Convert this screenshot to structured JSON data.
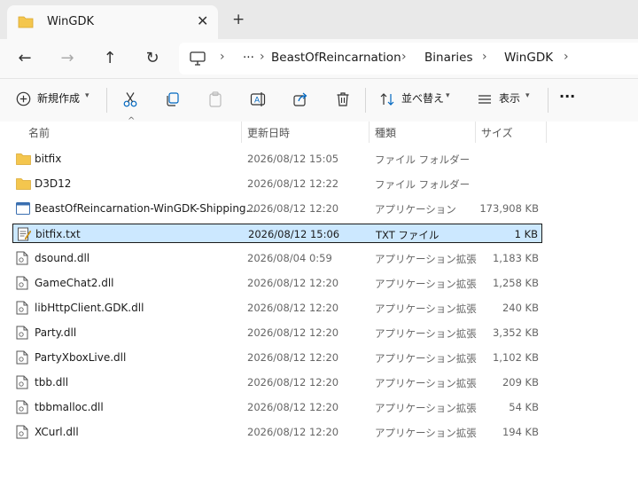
{
  "tab": {
    "title": "WinGDK",
    "close": "✕",
    "new_tab": "+"
  },
  "nav": {
    "back": "←",
    "forward": "→",
    "up": "↑",
    "refresh": "↻",
    "more": "···",
    "breadcrumbs": [
      "BeastOfReincarnation",
      "Binaries",
      "WinGDK"
    ],
    "separator": "›"
  },
  "toolbar": {
    "new_label": "新規作成",
    "sort_label": "並べ替え",
    "view_label": "表示",
    "more": "···"
  },
  "columns": {
    "name": "名前",
    "date": "更新日時",
    "type": "種類",
    "size": "サイズ"
  },
  "files": [
    {
      "name": "bitfix",
      "date": "2026/08/12 15:05",
      "type": "ファイル フォルダー",
      "size": "",
      "icon": "folder-icon"
    },
    {
      "name": "D3D12",
      "date": "2026/08/12 12:22",
      "type": "ファイル フォルダー",
      "size": "",
      "icon": "folder-icon"
    },
    {
      "name": "BeastOfReincarnation-WinGDK-Shipping...",
      "date": "2026/08/12 12:20",
      "type": "アプリケーション",
      "size": "173,908 KB",
      "icon": "exe-icon"
    },
    {
      "name": "bitfix.txt",
      "date": "2026/08/12 15:06",
      "type": "TXT ファイル",
      "size": "1 KB",
      "icon": "text-file-icon",
      "selected": true
    },
    {
      "name": "dsound.dll",
      "date": "2026/08/04 0:59",
      "type": "アプリケーション拡張",
      "size": "1,183 KB",
      "icon": "dll-icon"
    },
    {
      "name": "GameChat2.dll",
      "date": "2026/08/12 12:20",
      "type": "アプリケーション拡張",
      "size": "1,258 KB",
      "icon": "dll-icon"
    },
    {
      "name": "libHttpClient.GDK.dll",
      "date": "2026/08/12 12:20",
      "type": "アプリケーション拡張",
      "size": "240 KB",
      "icon": "dll-icon"
    },
    {
      "name": "Party.dll",
      "date": "2026/08/12 12:20",
      "type": "アプリケーション拡張",
      "size": "3,352 KB",
      "icon": "dll-icon"
    },
    {
      "name": "PartyXboxLive.dll",
      "date": "2026/08/12 12:20",
      "type": "アプリケーション拡張",
      "size": "1,102 KB",
      "icon": "dll-icon"
    },
    {
      "name": "tbb.dll",
      "date": "2026/08/12 12:20",
      "type": "アプリケーション拡張",
      "size": "209 KB",
      "icon": "dll-icon"
    },
    {
      "name": "tbbmalloc.dll",
      "date": "2026/08/12 12:20",
      "type": "アプリケーション拡張",
      "size": "54 KB",
      "icon": "dll-icon"
    },
    {
      "name": "XCurl.dll",
      "date": "2026/08/12 12:20",
      "type": "アプリケーション拡張",
      "size": "194 KB",
      "icon": "dll-icon"
    }
  ],
  "colors": {
    "folder": "#f4c64e",
    "selection": "#cce8ff",
    "accent": "#0067c0"
  }
}
